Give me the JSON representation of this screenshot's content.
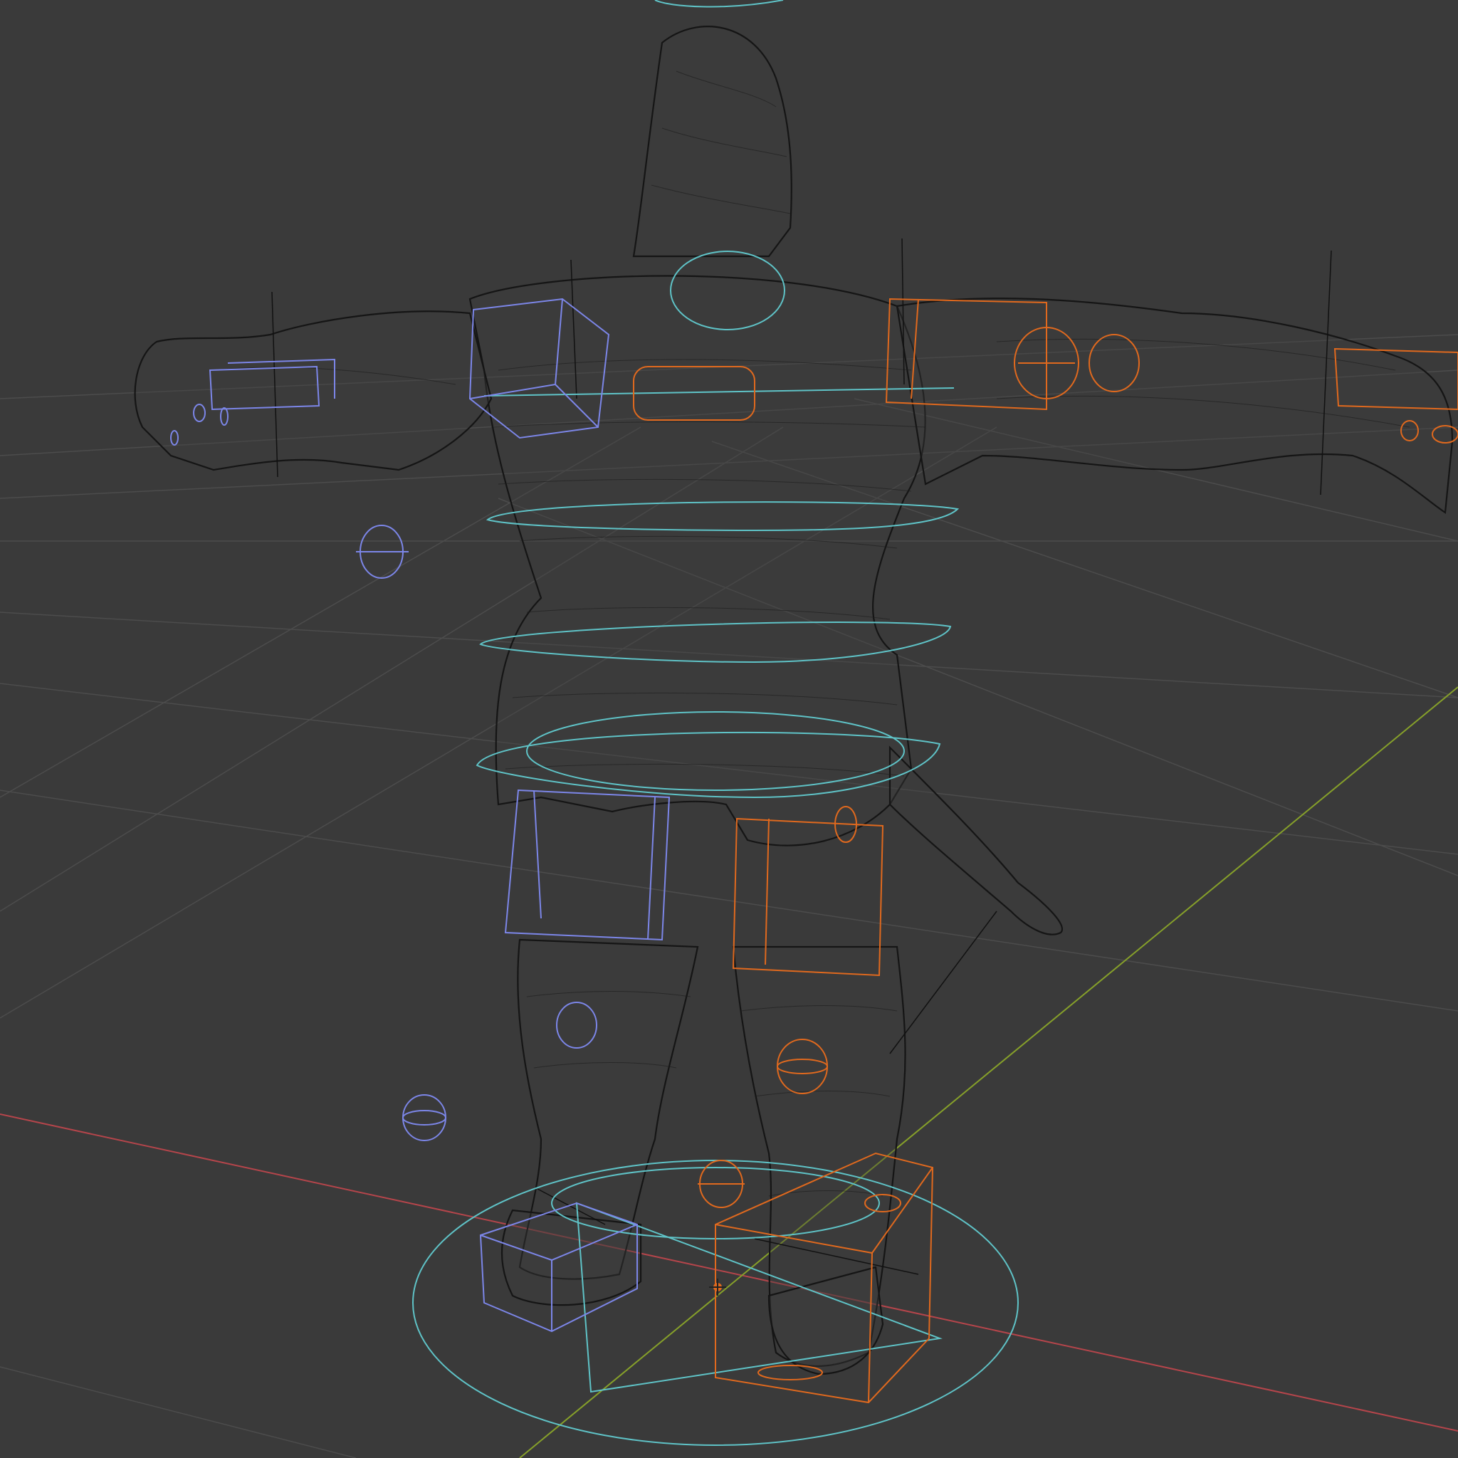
{
  "viewport": {
    "mode": "wireframe",
    "shading": "wireframe",
    "background_color": "#3a3a3a"
  },
  "scene": {
    "object": "rigged-humanoid-character",
    "pose": "T-pose",
    "mesh_color": "#141414",
    "grid_color": "#555555",
    "axis_x_color": "#c0454a",
    "axis_y_color": "#8aa22c"
  },
  "rig_controls": {
    "root_color": "#5fc3c7",
    "left_side_color": "#7c86e8",
    "right_side_color": "#e0691e",
    "items": [
      {
        "name": "root-circle",
        "side": "center",
        "shape": "circle"
      },
      {
        "name": "hips-ring",
        "side": "center",
        "shape": "ring"
      },
      {
        "name": "spine-ring-1",
        "side": "center",
        "shape": "ring"
      },
      {
        "name": "spine-ring-2",
        "side": "center",
        "shape": "ring"
      },
      {
        "name": "chest-ring",
        "side": "center",
        "shape": "ring"
      },
      {
        "name": "neck-ring",
        "side": "center",
        "shape": "ring"
      },
      {
        "name": "head-ring",
        "side": "center",
        "shape": "ring"
      },
      {
        "name": "shoulder-left",
        "side": "left",
        "shape": "box"
      },
      {
        "name": "hand-left",
        "side": "left",
        "shape": "box"
      },
      {
        "name": "elbow-pole-left",
        "side": "left",
        "shape": "sphere"
      },
      {
        "name": "thigh-left",
        "side": "left",
        "shape": "box"
      },
      {
        "name": "knee-pole-left",
        "side": "left",
        "shape": "sphere"
      },
      {
        "name": "foot-left",
        "side": "left",
        "shape": "box"
      },
      {
        "name": "shoulder-right",
        "side": "right",
        "shape": "box"
      },
      {
        "name": "hand-right",
        "side": "right",
        "shape": "box"
      },
      {
        "name": "thigh-right",
        "side": "right",
        "shape": "box"
      },
      {
        "name": "knee-right",
        "side": "right",
        "shape": "sphere"
      },
      {
        "name": "foot-right",
        "side": "right",
        "shape": "box"
      },
      {
        "name": "foot-pole-right",
        "side": "right",
        "shape": "sphere"
      }
    ]
  }
}
